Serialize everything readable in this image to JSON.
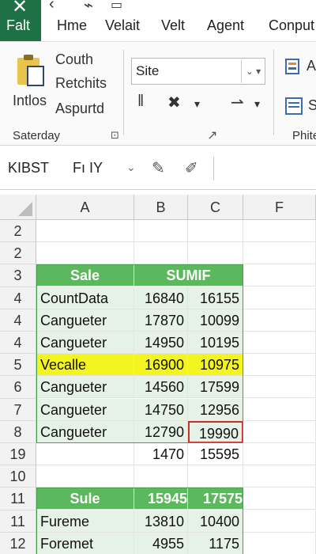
{
  "tabs": {
    "file": "Falt",
    "close_glyph": "✕",
    "items": [
      "Hme",
      "Velait",
      "Velt",
      "Agent",
      "Conput"
    ]
  },
  "ribbon": {
    "paste_label": "Intlos",
    "clipboard_items": [
      "Couth",
      "Retchits",
      "Aspurtd"
    ],
    "group_label": "Saterday",
    "font_name": "Site",
    "group2_label": "Phite",
    "right_label_a": "A",
    "right_label_s": "S"
  },
  "formula_bar": {
    "name_box": "KIBST",
    "content": "Fı IY"
  },
  "grid": {
    "columns": [
      "A",
      "B",
      "C",
      "F"
    ],
    "rows": [
      {
        "num": "2",
        "a": "",
        "b": "",
        "c": "",
        "style": "plain"
      },
      {
        "num": "2",
        "a": "",
        "b": "",
        "c": "",
        "style": "plain"
      },
      {
        "num": "3",
        "a": "Sale",
        "bc": "SUMIF",
        "style": "header"
      },
      {
        "num": "4",
        "a": "CountData",
        "b": "16840",
        "c": "16155",
        "style": "green"
      },
      {
        "num": "4",
        "a": "Cangueter",
        "b": "17870",
        "c": "10099",
        "style": "green"
      },
      {
        "num": "4",
        "a": "Cangueter",
        "b": "14950",
        "c": "10195",
        "style": "green"
      },
      {
        "num": "5",
        "a": "Vecalle",
        "b": "16900",
        "c": "10975",
        "style": "yellow"
      },
      {
        "num": "6",
        "a": "Cangueter",
        "b": "14560",
        "c": "17599",
        "style": "green"
      },
      {
        "num": "7",
        "a": "Cangueter",
        "b": "14750",
        "c": "12956",
        "style": "green"
      },
      {
        "num": "8",
        "a": "Cangueter",
        "b": "12790",
        "c": "19990",
        "style": "green-red"
      },
      {
        "num": "19",
        "a": "",
        "b": "1470",
        "c": "15595",
        "style": "plain"
      },
      {
        "num": "10",
        "a": "",
        "b": "",
        "c": "",
        "style": "plain"
      },
      {
        "num": "11",
        "a": "Sule",
        "b": "15945",
        "c": "17575",
        "style": "header2"
      },
      {
        "num": "11",
        "a": "Fureme",
        "b": "13810",
        "c": "10400",
        "style": "green"
      },
      {
        "num": "12",
        "a": "Foremet",
        "b": "4955",
        "c": "1175",
        "style": "green"
      }
    ]
  },
  "colors": {
    "file_tab": "#1e7145",
    "header_fill": "#5cb85c",
    "row_fill": "#e5f2e5",
    "highlight_fill": "#f4f421",
    "selection_border": "#c9302c"
  }
}
